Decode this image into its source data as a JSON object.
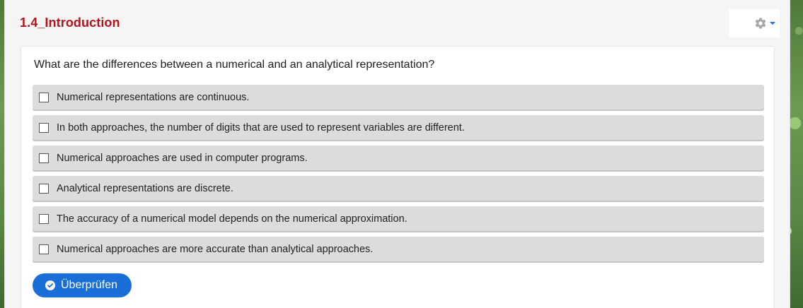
{
  "header": {
    "title": "1.4_Introduction",
    "settings_icon": "gear-icon"
  },
  "quiz": {
    "question": "What are the differences between a numerical and an analytical representation?",
    "options": [
      {
        "label": "Numerical representations are continuous.",
        "checked": false
      },
      {
        "label": "In both approaches, the number of digits that are used to represent variables are different.",
        "checked": false
      },
      {
        "label": "Numerical approaches are used in computer programs.",
        "checked": false
      },
      {
        "label": "Analytical representations are discrete.",
        "checked": false
      },
      {
        "label": "The accuracy of a numerical model depends on the numerical approximation.",
        "checked": false
      },
      {
        "label": "Numerical approaches are more accurate than analytical approaches.",
        "checked": false
      }
    ],
    "check_button": {
      "label": "Überprüfen",
      "icon": "check-circle-icon"
    }
  },
  "colors": {
    "title": "#b3141b",
    "accent": "#1a6ed8",
    "option_bg": "#dcdcdc"
  }
}
